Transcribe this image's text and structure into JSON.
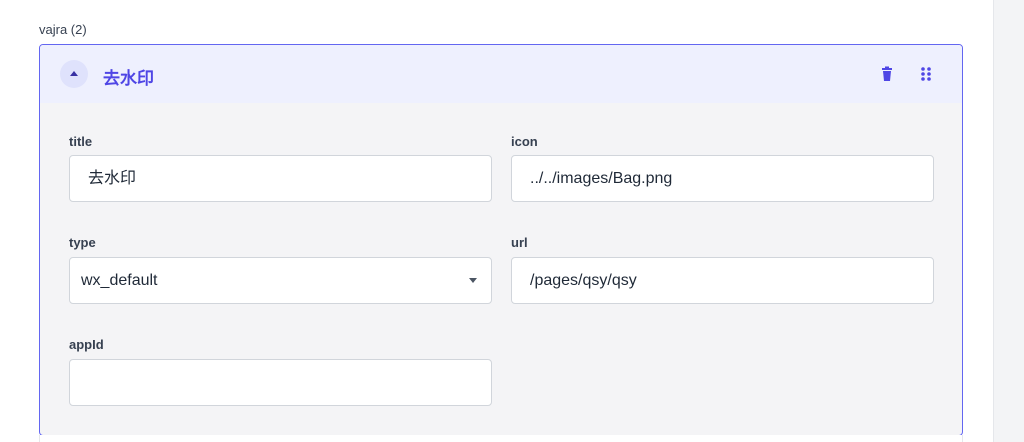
{
  "section": {
    "label": "vajra (2)"
  },
  "card": {
    "title": "去水印",
    "icons": {
      "toggle": "chevron-up-icon",
      "delete": "trash-icon",
      "drag": "drag-handle-icon"
    },
    "colors": {
      "accent": "#4f46e5",
      "border": "#6366f1",
      "header_bg": "#eef0fe"
    }
  },
  "fields": {
    "title": {
      "label": "title",
      "value": "去水印"
    },
    "icon": {
      "label": "icon",
      "value": "../../images/Bag.png"
    },
    "type": {
      "label": "type",
      "value": "wx_default"
    },
    "url": {
      "label": "url",
      "value": "/pages/qsy/qsy"
    },
    "appId": {
      "label": "appId",
      "value": ""
    }
  }
}
